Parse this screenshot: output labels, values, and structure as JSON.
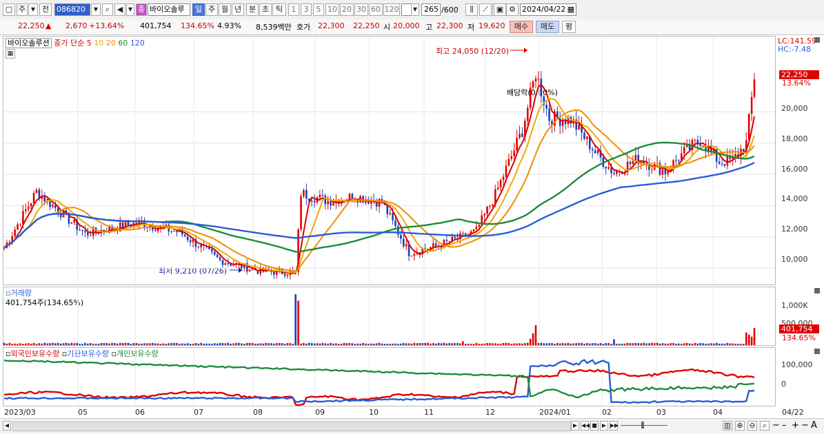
{
  "toolbar": {
    "type_label": "주",
    "prev_label": "전",
    "code": "086820",
    "stock_badge": "종",
    "stock_name": "바이오솔루",
    "periods": [
      "일",
      "주",
      "월",
      "년",
      "분",
      "초",
      "틱"
    ],
    "period_selected": "일",
    "intervals": [
      "1",
      "3",
      "5",
      "10",
      "20",
      "30",
      "60",
      "120"
    ],
    "count_value": "265",
    "count_max": "/600",
    "date": "2024/04/22"
  },
  "quote": {
    "price": "22,250",
    "change_arrow": "▲",
    "change": "2,670",
    "change_pct": "+13.64%",
    "volume": "401,754",
    "volume_ratio": "134.65%",
    "turnover_pct": "4.93%",
    "amount": "8,539백만",
    "ask_label": "호가",
    "ask": "22,300",
    "bid": "22,250",
    "open_label": "시",
    "open": "20,000",
    "high_label": "고",
    "high": "22,300",
    "low_label": "저",
    "low": "19,620",
    "buy_label": "매수",
    "sell_label": "매도",
    "eval_label": "평"
  },
  "price_panel": {
    "name": "바이오솔루션",
    "ma_label": "종가 단순",
    "ma_periods": [
      "5",
      "10",
      "20",
      "60",
      "120"
    ],
    "ma_colors": [
      "#e00000",
      "#f0a800",
      "#f08c00",
      "#1a8c3a",
      "#2a5cd8"
    ],
    "lc": "LC:141.59",
    "hc": "HC:-7.48",
    "current_price": "22,250",
    "current_pct": "13.64%",
    "y_ticks": [
      "20,000",
      "18,000",
      "16,000",
      "14,000",
      "12,000",
      "10,000"
    ],
    "high_note": "최고 24,050 (12/20)",
    "low_note": "최저 9,210 (07/26)",
    "dividend_note": "배당락(0.00%)"
  },
  "volume_panel": {
    "title": "거래량",
    "value_text": "401,754주(134.65%)",
    "y_ticks": [
      "1,000K",
      "500,000"
    ],
    "current": "401,754",
    "current_pct": "134.65%"
  },
  "holdings_panel": {
    "legend": [
      "외국인보유수량",
      "기관보유수량",
      "개인보유수량"
    ],
    "legend_colors": [
      "#e00000",
      "#2a5cd8",
      "#1a8c3a"
    ],
    "y_ticks": [
      "100,000",
      "0"
    ]
  },
  "x_axis": [
    "2023/03",
    "05",
    "06",
    "07",
    "08",
    "09",
    "10",
    "11",
    "12",
    "2024/01",
    "02",
    "03",
    "04",
    "04/22"
  ],
  "chart_data": {
    "type": "line",
    "title": "바이오솔루션",
    "x": [
      "2023/03",
      "05",
      "06",
      "07",
      "08",
      "09",
      "10",
      "11",
      "12",
      "2024/01",
      "02",
      "03",
      "04",
      "04/22"
    ],
    "ylim": [
      9000,
      24500
    ],
    "series": [
      {
        "name": "5",
        "values": [
          11400,
          14500,
          12600,
          12300,
          10300,
          9800,
          14200,
          13800,
          11300,
          12400,
          20600,
          17900,
          16500,
          17300,
          22250
        ]
      },
      {
        "name": "120",
        "values": [
          11500,
          12000,
          12100,
          12200,
          12000,
          11900,
          12200,
          12300,
          12100,
          12200,
          13800,
          14800,
          15400,
          15800,
          16200
        ]
      }
    ],
    "annotations": [
      {
        "label": "최고 24,050 (12/20)",
        "value": 24050
      },
      {
        "label": "최저 9,210 (07/26)",
        "value": 9210
      }
    ]
  }
}
